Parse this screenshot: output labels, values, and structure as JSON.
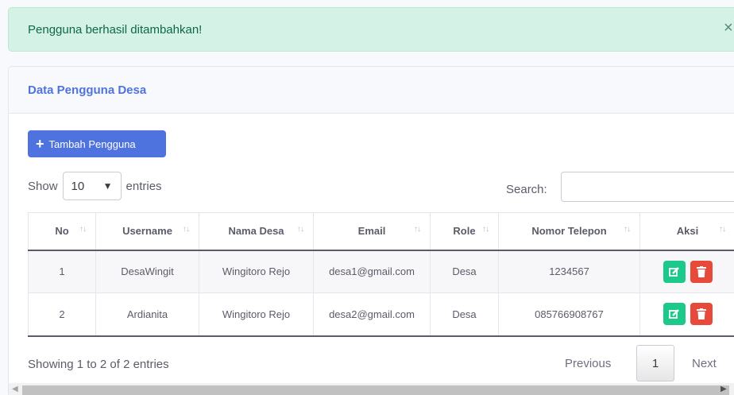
{
  "alert": {
    "message": "Pengguna berhasil ditambahkan!",
    "close_icon": "×"
  },
  "card": {
    "title": "Data Pengguna Desa",
    "add_button": "Tambah Pengguna",
    "show_label": "Show",
    "entries_value": "10",
    "entries_label": "entries",
    "search_label": "Search:",
    "search_value": ""
  },
  "table": {
    "headers": [
      "No",
      "Username",
      "Nama Desa",
      "Email",
      "Role",
      "Nomor Telepon",
      "Aksi"
    ],
    "rows": [
      [
        "1",
        "DesaWingit",
        "Wingitoro Rejo",
        "desa1@gmail.com",
        "Desa",
        "1234567"
      ],
      [
        "2",
        "Ardianita",
        "Wingitoro Rejo",
        "desa2@gmail.com",
        "Desa",
        "085766908767"
      ]
    ]
  },
  "footer": {
    "info": "Showing 1 to 2 of 2 entries",
    "previous": "Previous",
    "page": "1",
    "next": "Next"
  },
  "colors": {
    "primary": "#4e73df",
    "success": "#1cc88a",
    "danger": "#e74a3b",
    "alert_bg": "#d4f2e6"
  },
  "icons": {
    "add": "plus-icon",
    "edit": "edit-icon",
    "delete": "trash-icon",
    "close": "close-icon",
    "sort": "sort-icon"
  }
}
